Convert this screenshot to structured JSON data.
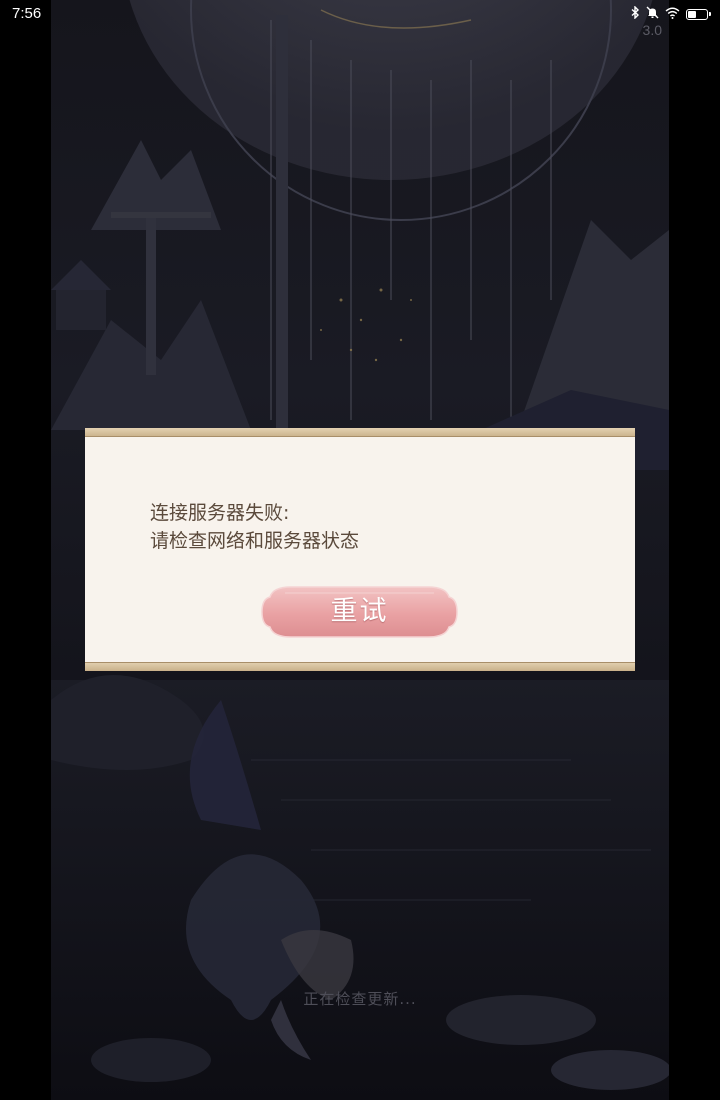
{
  "status_bar": {
    "time": "7:56",
    "icons": [
      "bluetooth-icon",
      "mute-icon",
      "wifi-icon",
      "battery-icon"
    ]
  },
  "game": {
    "version": "3.0",
    "loading_text": "正在检查更新..."
  },
  "dialog": {
    "message_line1": "连接服务器失败:",
    "message_line2": "请检查网络和服务器状态",
    "retry_label": "重试"
  },
  "colors": {
    "dialog_bg": "#f8f3ed",
    "dialog_border": "#d4bd96",
    "dialog_text": "#5b4a3c",
    "button_pink": "#eba4a6",
    "scene_dark": "#15151c"
  }
}
